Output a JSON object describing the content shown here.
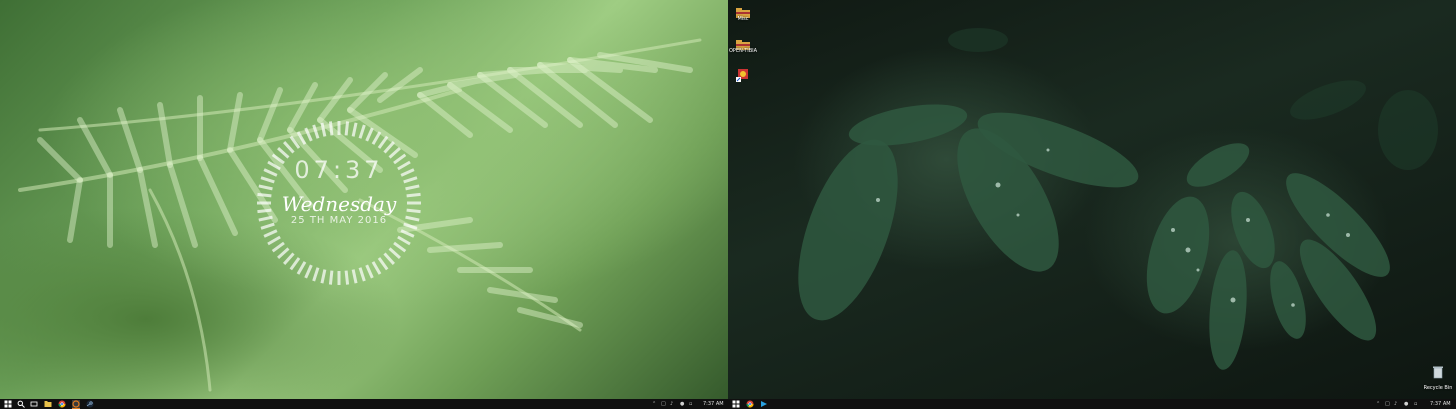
{
  "left_monitor": {
    "clock_widget": {
      "time": "07:37",
      "day": "Wednesday",
      "date": "25 TH MAY 2016"
    },
    "taskbar": {
      "icons": [
        "windows-icon",
        "search-icon",
        "task-view-icon",
        "file-explorer-icon",
        "chrome-icon",
        "app-icon-orange",
        "steam-icon"
      ],
      "active_icon": "app-icon-orange",
      "accent_color": "#e07a1f",
      "time": "7:37 AM"
    }
  },
  "right_monitor": {
    "desktop_icons": [
      {
        "label": "Misc",
        "icon": "folder-icon"
      },
      {
        "label": "OPEN-TIBIA",
        "icon": "folder-icon"
      },
      {
        "label": "",
        "icon": "app-shortcut-icon"
      }
    ],
    "recycle_bin": {
      "label": "Recycle Bin",
      "icon": "recycle-bin-icon"
    },
    "taskbar": {
      "icons": [
        "windows-icon",
        "chrome-icon",
        "app-icon-blue"
      ],
      "time": "7:37 AM"
    }
  }
}
